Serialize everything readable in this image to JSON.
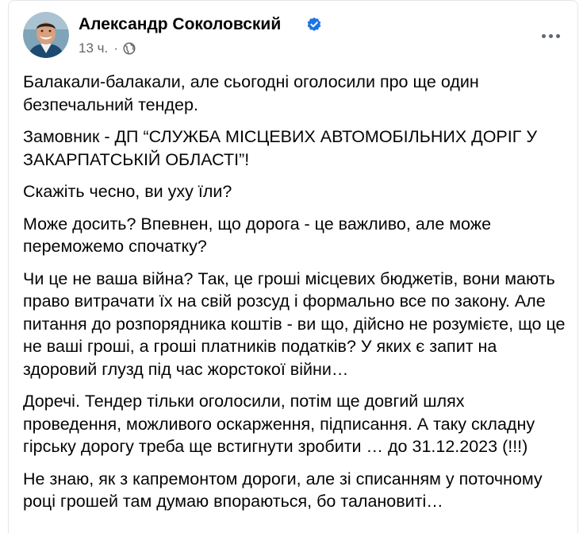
{
  "post": {
    "author": "Александр Соколовский",
    "time": "13 ч.",
    "separator": "·",
    "paragraphs": [
      "Балакали-балакали, але сьогодні оголосили про ще один безпечальний тендер.",
      "Замовник - ДП “СЛУЖБА МІСЦЕВИХ АВТОМОБІЛЬНИХ ДОРІГ У ЗАКАРПАТСЬКІЙ ОБЛАСТІ”!",
      "Скажіть чесно, ви уху їли?",
      "Може досить? Впевнен, що дорога - це важливо, але може переможемо спочатку?",
      "Чи це не ваша війна? Так, це гроші місцевих бюджетів, вони мають право витрачати їх на свій розсуд і формально все по закону. Але питання до розпорядника коштів - ви що, дійсно не розумієте, що це не ваші гроші, а гроші платників податків? У яких є запит на здоровий глузд під час жорстокої війни…",
      "Доречі. Тендер тільки оголосили, потім ще довгий шлях проведення, можливого оскарження, підписання. А таку складну гірську дорогу треба ще встигнути зробити … до 31.12.2023 (!!!)",
      "Не знаю, як з капремонтом дороги, але зі списанням у поточному році грошей там думаю впораються, бо талановиті…"
    ]
  },
  "icons": {
    "avatar": "avatar-photo",
    "verified": "verified-badge-icon",
    "audience": "globe-icon",
    "more": "more-options-icon"
  },
  "colors": {
    "text": "#050505",
    "secondary": "#65676b",
    "verified": "#1b74e4",
    "border": "#e4e6eb"
  }
}
